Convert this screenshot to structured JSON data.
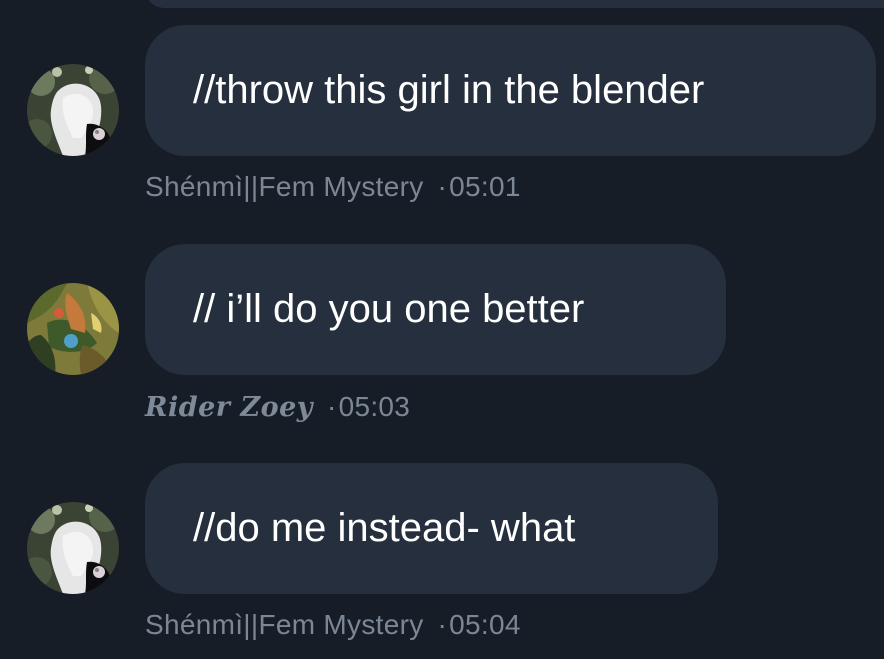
{
  "messages": [
    {
      "text": "//throw this girl in the blender",
      "author": "Shénmì||Fem Mystery",
      "separator": "·",
      "time": "05:01",
      "avatar_icon": "avatar-white-hair-icon"
    },
    {
      "text": "// i’ll do you one better",
      "author": "Rider Zoey",
      "separator": "·",
      "time": "05:03",
      "avatar_icon": "avatar-jungle-art-icon"
    },
    {
      "text": "//do me instead- what",
      "author": "Shénmì||Fem Mystery",
      "separator": "·",
      "time": "05:04",
      "avatar_icon": "avatar-white-hair-icon"
    }
  ],
  "colors": {
    "background": "#161d27",
    "bubble": "#252f3d",
    "message_text": "#ffffff",
    "meta_text": "#7c8796"
  }
}
